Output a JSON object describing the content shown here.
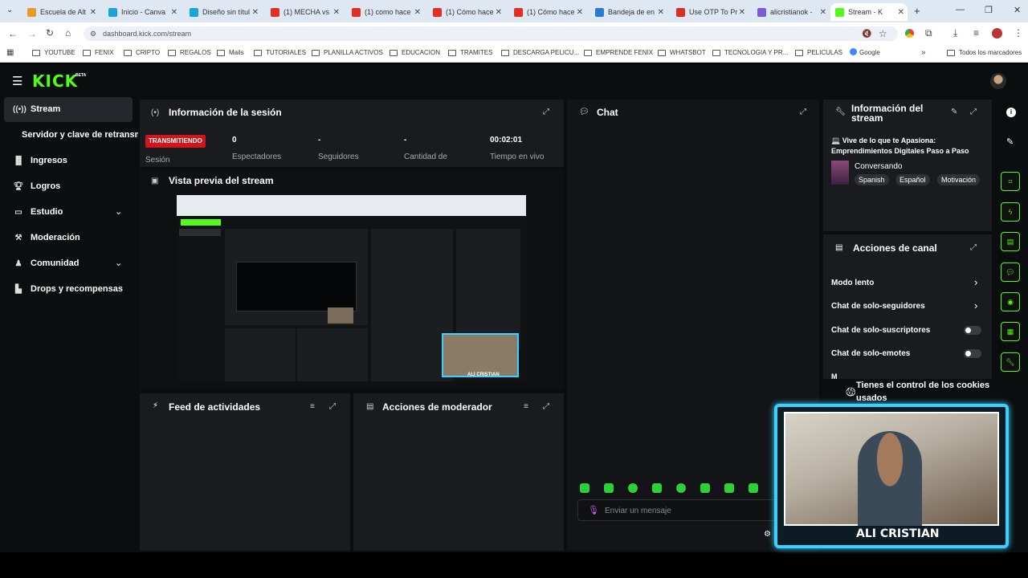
{
  "browser": {
    "tabs": [
      {
        "label": "Escuela de Alt",
        "color": "#e89b2c"
      },
      {
        "label": "Inicio - Canva",
        "color": "#1aa3d8"
      },
      {
        "label": "Diseño sin títul",
        "color": "#1aa3d8"
      },
      {
        "label": "(1) MECHA vs",
        "color": "#e52d27"
      },
      {
        "label": "(1) como hace",
        "color": "#e52d27"
      },
      {
        "label": "(1) Cómo hace",
        "color": "#e52d27"
      },
      {
        "label": "(1) Cómo hace",
        "color": "#e52d27"
      },
      {
        "label": "Bandeja de en",
        "color": "#2a7bd4"
      },
      {
        "label": "Use OTP To Pr",
        "color": "#d93025"
      },
      {
        "label": "alicristianok -",
        "color": "#7b5cd6"
      },
      {
        "label": "Stream - K",
        "color": "#53fc18"
      }
    ],
    "url": "dashboard.kick.com/stream",
    "bookmarks": [
      "YOUTUBE",
      "FENIX",
      "CRIPTO",
      "REGALOS",
      "Mails",
      "TUTORIALES",
      "PLANILLA ACTIVOS",
      "EDUCACION",
      "TRAMITES",
      "DESCARGA PELICU...",
      "EMPRENDE FENIX",
      "WHATSBOT",
      "TECNOLOGIA Y PR...",
      "PELICULAS",
      "Google"
    ],
    "all_bookmarks": "Todos los marcadores"
  },
  "app": {
    "logo": "KICK",
    "logo_badge": "BETA",
    "accent": "#53fc18",
    "sidebar": [
      {
        "label": "Stream",
        "icon": "broadcast-icon"
      },
      {
        "label": "Servidor y clave de retransmi",
        "icon": ""
      },
      {
        "label": "Ingresos",
        "icon": "chart-icon"
      },
      {
        "label": "Logros",
        "icon": "trophy-icon"
      },
      {
        "label": "Estudio",
        "icon": "studio-icon"
      },
      {
        "label": "Moderación",
        "icon": "hammer-icon"
      },
      {
        "label": "Comunidad",
        "icon": "community-icon"
      },
      {
        "label": "Drops y recompensas",
        "icon": "drops-icon"
      }
    ]
  },
  "session": {
    "title": "Información de la sesión",
    "live_badge": "TRANSMITIENDO",
    "session_label": "Sesión",
    "stats": [
      {
        "value": "0",
        "label": "Espectadores"
      },
      {
        "value": "-",
        "label": "Seguidores"
      },
      {
        "value": "-",
        "label": "Cantidad de"
      },
      {
        "value": "00:02:01",
        "label": "Tiempo en vivo"
      }
    ]
  },
  "preview": {
    "title": "Vista previa del stream",
    "cam_name": "ALI CRISTIAN"
  },
  "feed": {
    "title": "Feed de actividades"
  },
  "modactions": {
    "title": "Acciones de moderador"
  },
  "chat": {
    "title": "Chat",
    "placeholder": "Enviar un mensaje"
  },
  "stream_info": {
    "title_line1": "Información del",
    "title_line2": "stream",
    "stream_title_line1": "💻 Vive de lo que te Apasiona:",
    "stream_title_line2": "Emprendimientos Digitales Paso a Paso",
    "category": "Conversando",
    "tags": [
      "Spanish",
      "Español",
      "Motivación"
    ]
  },
  "channel_actions": {
    "title": "Acciones de canal",
    "rows": [
      {
        "label": "Modo lento",
        "control": "chevron"
      },
      {
        "label": "Chat de solo-seguidores",
        "control": "chevron"
      },
      {
        "label": "Chat de solo-suscriptores",
        "control": "toggle"
      },
      {
        "label": "Chat de solo-emotes",
        "control": "toggle"
      }
    ],
    "partial": "M"
  },
  "cookie_notice": {
    "line1": "Tienes el control de los cookies",
    "line2": "usados"
  },
  "webcam": {
    "name": "ALI CRISTIAN"
  }
}
